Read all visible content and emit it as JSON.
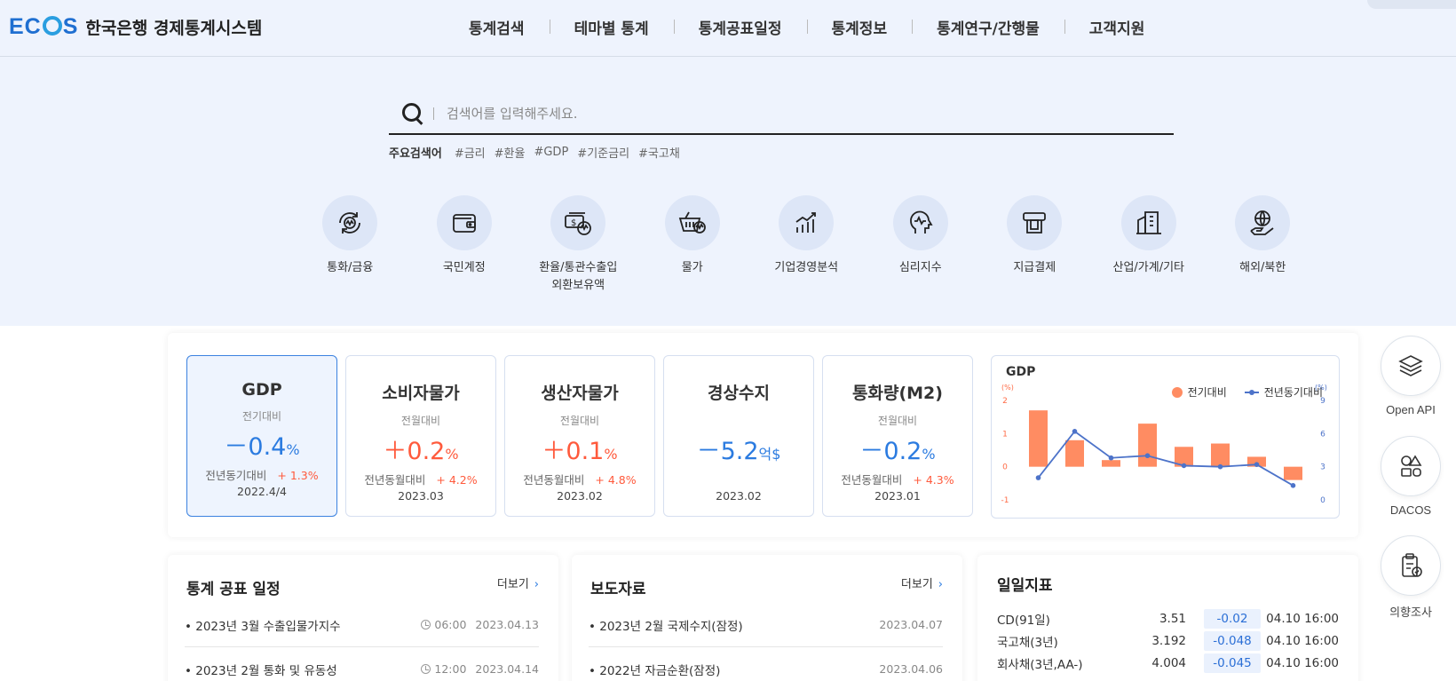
{
  "header": {
    "logo_mark": "ECOS",
    "logo_text": "한국은행 경제통계시스템",
    "nav": [
      "통계검색",
      "테마별 통계",
      "통계공표일정",
      "통계정보",
      "통계연구/간행물",
      "고객지원"
    ]
  },
  "search": {
    "placeholder": "검색어를 입력해주세요.",
    "keyword_label": "주요검색어",
    "keywords": [
      "#금리",
      "#환율",
      "#GDP",
      "#기준금리",
      "#국고채"
    ]
  },
  "categories": [
    {
      "label": "통화/금융",
      "icon": "currency-cycle-icon"
    },
    {
      "label": "국민계정",
      "icon": "wallet-icon"
    },
    {
      "label": "환율/통관수출입\n외환보유액",
      "icon": "exchange-money-icon"
    },
    {
      "label": "물가",
      "icon": "basket-icon"
    },
    {
      "label": "기업경영분석",
      "icon": "bar-growth-icon"
    },
    {
      "label": "심리지수",
      "icon": "head-pulse-icon"
    },
    {
      "label": "지급결제",
      "icon": "card-payment-icon"
    },
    {
      "label": "산업/가계/기타",
      "icon": "building-icon"
    },
    {
      "label": "해외/북한",
      "icon": "globe-hand-icon"
    }
  ],
  "indicators": [
    {
      "title": "GDP",
      "sub": "전기대비",
      "sign": "－",
      "value": "0.4",
      "unit": "%",
      "direction": "down",
      "yoy_label": "전년동기대비",
      "yoy": "+ 1.3%",
      "date": "2022.4/4",
      "active": true
    },
    {
      "title": "소비자물가",
      "sub": "전월대비",
      "sign": "＋",
      "value": "0.2",
      "unit": "%",
      "direction": "up",
      "yoy_label": "전년동월대비",
      "yoy": "+ 4.2%",
      "date": "2023.03",
      "active": false
    },
    {
      "title": "생산자물가",
      "sub": "전월대비",
      "sign": "＋",
      "value": "0.1",
      "unit": "%",
      "direction": "up",
      "yoy_label": "전년동월대비",
      "yoy": "+ 4.8%",
      "date": "2023.02",
      "active": false
    },
    {
      "title": "경상수지",
      "sub": "",
      "sign": "－",
      "value": "5.2",
      "unit": "억$",
      "direction": "down",
      "yoy_label": "",
      "yoy": "",
      "date": "2023.02",
      "active": false
    },
    {
      "title": "통화량(M2)",
      "sub": "전월대비",
      "sign": "－",
      "value": "0.2",
      "unit": "%",
      "direction": "down",
      "yoy_label": "전년동월대비",
      "yoy": "+ 4.3%",
      "date": "2023.01",
      "active": false
    }
  ],
  "chart_data": {
    "type": "bar",
    "title": "GDP",
    "left_unit": "(%)",
    "right_unit": "(%)",
    "left_ticks": [
      "2",
      "1",
      "0",
      "-1"
    ],
    "right_ticks": [
      "9",
      "6",
      "3",
      "0"
    ],
    "ylim": [
      -1,
      2
    ],
    "y2lim": [
      0,
      9
    ],
    "series": [
      {
        "name": "전기대비",
        "kind": "bar",
        "color": "#ff8c62",
        "values": [
          1.7,
          0.8,
          0.2,
          1.3,
          0.6,
          0.7,
          0.3,
          -0.4
        ]
      },
      {
        "name": "전년동기대비",
        "kind": "line",
        "color": "#4d73c9",
        "values": [
          2.0,
          6.2,
          3.8,
          4.0,
          3.1,
          3.0,
          3.2,
          1.3
        ]
      }
    ],
    "legend_position": "top-right"
  },
  "float_menu": [
    {
      "label": "Open API",
      "icon": "layers-icon"
    },
    {
      "label": "DACOS",
      "icon": "shapes-icon"
    },
    {
      "label": "의향조사",
      "icon": "clipboard-check-icon"
    }
  ],
  "schedule": {
    "title": "통계 공표 일정",
    "more": "더보기",
    "rows": [
      {
        "text": "• 2023년 3월 수출입물가지수",
        "time": "06:00",
        "date": "2023.04.13"
      },
      {
        "text": "• 2023년 2월 통화 및 유동성",
        "time": "12:00",
        "date": "2023.04.14"
      }
    ]
  },
  "press": {
    "title": "보도자료",
    "more": "더보기",
    "rows": [
      {
        "text": "• 2023년 2월 국제수지(잠정)",
        "date": "2023.04.07"
      },
      {
        "text": "• 2022년 자금순환(잠정)",
        "date": "2023.04.06"
      }
    ]
  },
  "daily": {
    "title": "일일지표",
    "rows": [
      {
        "name": "CD(91일)",
        "value": "3.51",
        "change": "-0.02",
        "time": "04.10 16:00"
      },
      {
        "name": "국고채(3년)",
        "value": "3.192",
        "change": "-0.048",
        "time": "04.10 16:00"
      },
      {
        "name": "회사채(3년,AA-)",
        "value": "4.004",
        "change": "-0.045",
        "time": "04.10 16:00"
      }
    ]
  }
}
